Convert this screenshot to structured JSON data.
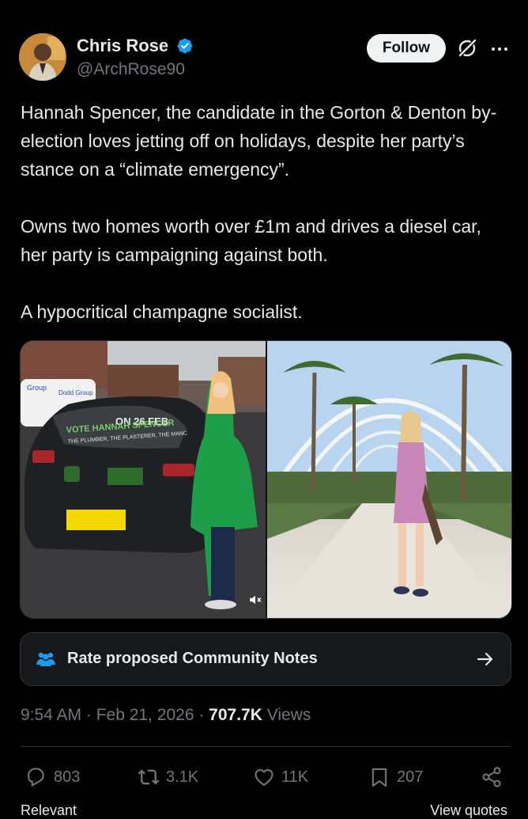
{
  "author": {
    "name": "Chris Rose",
    "handle": "@ArchRose90",
    "verified": true,
    "follow_label": "Follow"
  },
  "tweet": {
    "paragraphs": [
      "Hannah Spencer, the candidate in the Gorton & Denton by-election loves jetting off on holidays, despite her party’s stance on a “climate emergency”.",
      "Owns two homes worth over £1m and drives a diesel car, her party is campaigning against both.",
      "A hypocritical champagne socialist."
    ]
  },
  "media": {
    "left_photo": {
      "van_text_1": "Group",
      "van_text_2": "Dodd Group",
      "banner_line_1": "ON 26 FEB",
      "banner_line_2": "VOTE HANNAH SPENCER",
      "banner_line_3": "THE PLUMBER, THE PLASTERER, THE MANC"
    }
  },
  "community_notes": {
    "label": "Rate proposed Community Notes"
  },
  "meta": {
    "time": "9:54 AM",
    "date": "Feb 21, 2026",
    "views_count": "707.7K",
    "views_label": "Views"
  },
  "actions": {
    "replies": "803",
    "reposts": "3.1K",
    "likes": "11K",
    "bookmarks": "207"
  },
  "footer_cutoff": {
    "left": "Relevant",
    "right": "View quotes"
  },
  "colors": {
    "background": "#000000",
    "text_primary": "#e7e9ea",
    "text_secondary": "#71767b",
    "verified_blue": "#1d9bf0",
    "border": "#2f3336"
  }
}
